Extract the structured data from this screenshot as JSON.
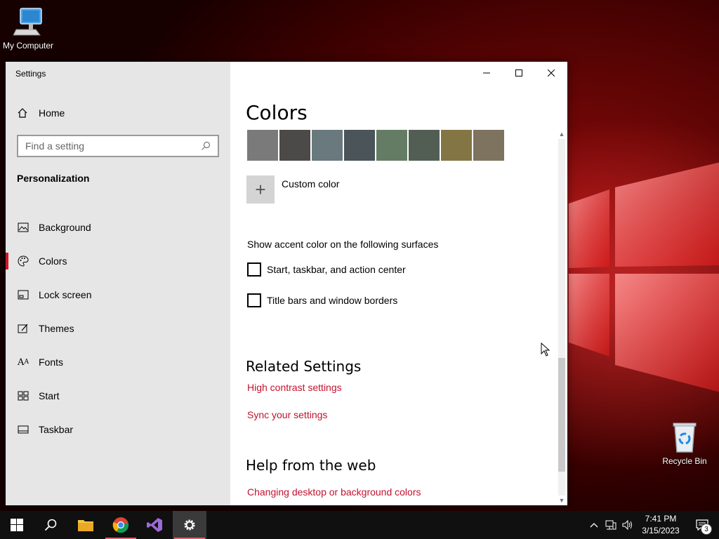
{
  "desktop": {
    "icons": [
      {
        "label": "My Computer"
      },
      {
        "label": "Recycle Bin"
      }
    ]
  },
  "window": {
    "app_title": "Settings",
    "sidebar": {
      "home_label": "Home",
      "search_placeholder": "Find a setting",
      "section_title": "Personalization",
      "items": [
        {
          "label": "Background",
          "icon": "image-icon"
        },
        {
          "label": "Colors",
          "icon": "palette-icon",
          "active": true
        },
        {
          "label": "Lock screen",
          "icon": "lock-screen-icon"
        },
        {
          "label": "Themes",
          "icon": "themes-icon"
        },
        {
          "label": "Fonts",
          "icon": "fonts-icon"
        },
        {
          "label": "Start",
          "icon": "start-icon"
        },
        {
          "label": "Taskbar",
          "icon": "taskbar-icon"
        }
      ]
    },
    "content": {
      "title": "Colors",
      "swatches": [
        "#7a7a7a",
        "#4c4a48",
        "#69797e",
        "#4a5459",
        "#647c64",
        "#525e54",
        "#847545",
        "#7e735f"
      ],
      "custom_color_label": "Custom color",
      "surfaces_label": "Show accent color on the following surfaces",
      "checkboxes": [
        {
          "label": "Start, taskbar, and action center",
          "checked": false
        },
        {
          "label": "Title bars and window borders",
          "checked": false
        }
      ],
      "related_title": "Related Settings",
      "related_links": [
        "High contrast settings",
        "Sync your settings"
      ],
      "help_title": "Help from the web",
      "help_links": [
        "Changing desktop or background colors"
      ]
    },
    "accent_color": "#c4112d"
  },
  "taskbar": {
    "clock_time": "7:41 PM",
    "clock_date": "3/15/2023",
    "notification_count": "3"
  }
}
